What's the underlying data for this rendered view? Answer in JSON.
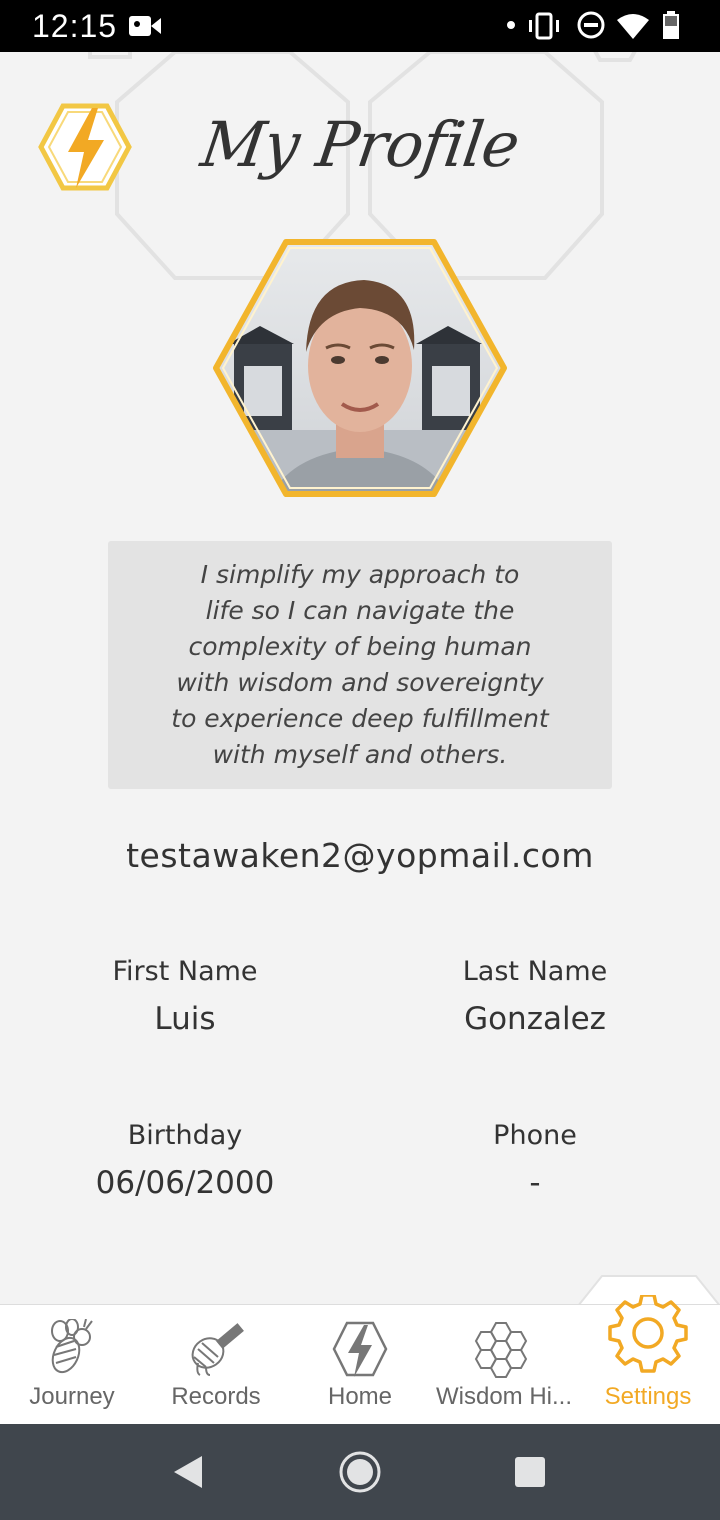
{
  "status_bar": {
    "time": "12:15",
    "icons": [
      "video-camera-icon",
      "dot-icon",
      "vibrate-icon",
      "do-not-disturb-icon",
      "wifi-icon",
      "battery-icon"
    ]
  },
  "header": {
    "logo_icon": "lightning-hexagon-icon",
    "title": "My Profile"
  },
  "profile": {
    "avatar_alt": "profile-photo",
    "bio": "I simplify my approach to life so I can navigate the complexity of being human with wisdom and sovereignty to experience deep fulfillment with myself and others.",
    "bio_lines": [
      "I simplify my approach to",
      "life so I can navigate the",
      "complexity of being human",
      "with wisdom and sovereignty",
      "to experience deep fulfillment",
      "with myself and others."
    ],
    "email": "testawaken2@yopmail.com",
    "first_name_label": "First Name",
    "first_name": "Luis",
    "last_name_label": "Last Name",
    "last_name": "Gonzalez",
    "birthday_label": "Birthday",
    "birthday": "06/06/2000",
    "phone_label": "Phone",
    "phone": "-"
  },
  "bottom_nav": {
    "items": [
      {
        "label": "Journey",
        "icon": "bee-icon"
      },
      {
        "label": "Records",
        "icon": "honey-dipper-icon"
      },
      {
        "label": "Home",
        "icon": "lightning-hexagon-icon"
      },
      {
        "label": "Wisdom Hi...",
        "icon": "honeycomb-icon"
      },
      {
        "label": "Settings",
        "icon": "gear-icon"
      }
    ],
    "active": "Settings",
    "active_color": "#f2a924",
    "inactive_color": "#666666"
  },
  "android_nav": {
    "buttons": [
      "back-button",
      "home-button",
      "recents-button"
    ]
  },
  "colors": {
    "accent": "#f2a924",
    "background": "#f3f3f3",
    "bio_background": "#e3e3e3"
  }
}
